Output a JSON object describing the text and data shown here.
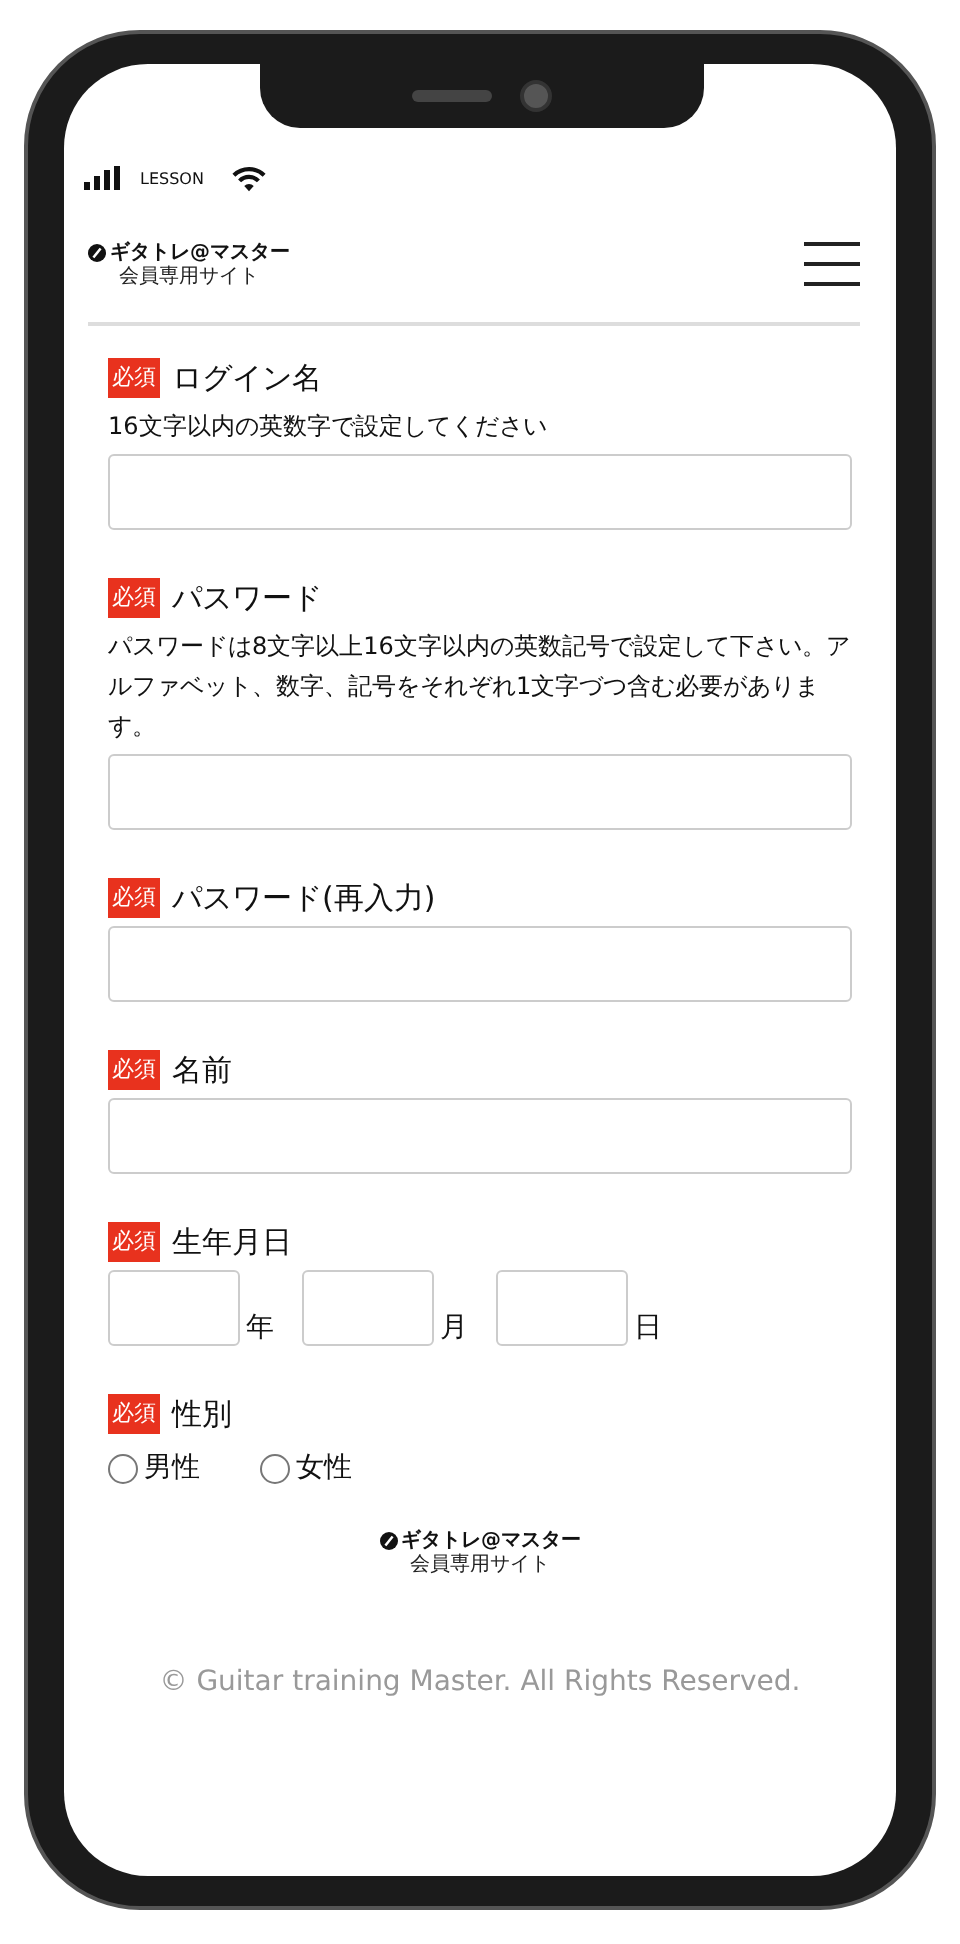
{
  "status_bar": {
    "carrier": "LESSON"
  },
  "header": {
    "logo_title": "ギタトレ@マスター",
    "logo_subtitle": "会員専用サイト"
  },
  "form": [
    {
      "kind": "text",
      "badge": "必須",
      "label": "ログイン名",
      "hint": "16文字以内の英数字で設定してください"
    },
    {
      "kind": "text",
      "badge": "必須",
      "label": "パスワード",
      "hint": "パスワードは8文字以上16文字以内の英数記号で設定して下さい。アルファベット、数字、記号をそれぞれ1文字づつ含む必要があります。"
    },
    {
      "kind": "text",
      "badge": "必須",
      "label": "パスワード(再入力)"
    },
    {
      "kind": "text",
      "badge": "必須",
      "label": "名前"
    },
    {
      "kind": "date",
      "badge": "必須",
      "label": "生年月日",
      "units": [
        "年",
        "月",
        "日"
      ]
    },
    {
      "kind": "radio",
      "badge": "必須",
      "label": "性別",
      "options": [
        {
          "label": "男性",
          "selected": false
        },
        {
          "label": "女性",
          "selected": false
        }
      ]
    }
  ],
  "footer": {
    "logo_title": "ギタトレ@マスター",
    "logo_subtitle": "会員専用サイト",
    "copyright": "© Guitar training Master. All Rights Reserved."
  }
}
